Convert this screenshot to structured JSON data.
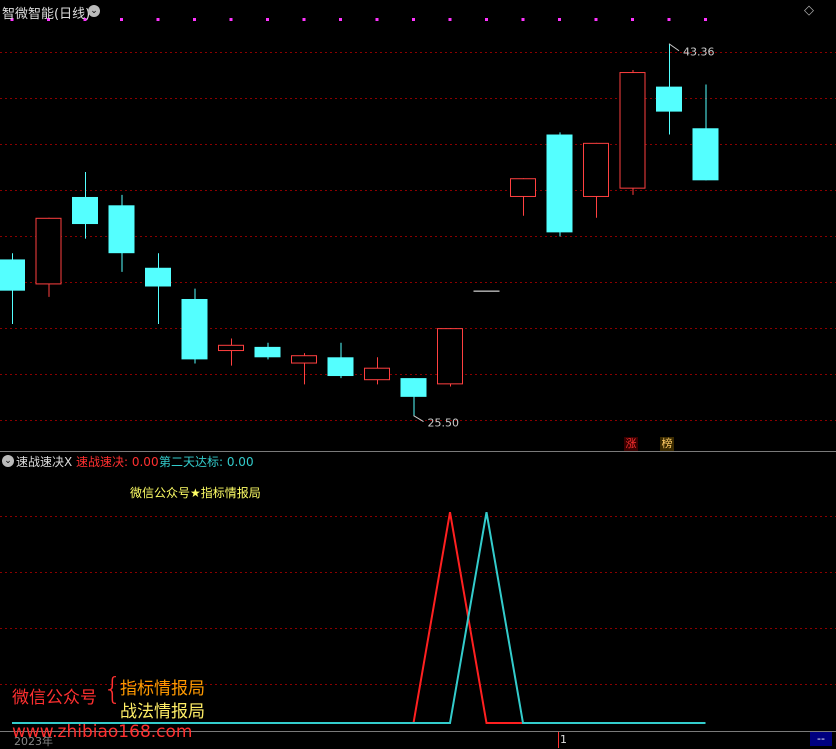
{
  "main_panel": {
    "title": "智微智能(日线)",
    "high_label": "43.36",
    "low_label": "25.50",
    "badge_left": "涨",
    "badge_right": "榜"
  },
  "indicator_panel": {
    "title": "速战速决X",
    "legend": [
      {
        "label": "速战速决: 0.00",
        "color": "#ff3030"
      },
      {
        "label": "第二天达标: 0.00",
        "color": "#33cccc"
      }
    ],
    "watermark": "微信公众号★指标情报局",
    "promo_left": "微信公众号",
    "promo_line1": "指标情报局",
    "promo_line2": "战法情报局",
    "url": "www.zhibiao168.com",
    "year_label": "2023年",
    "cursor_label": "1",
    "corner_label": "--"
  },
  "colors": {
    "up": "#ff4040",
    "down": "#54ffff",
    "grid": "#8b0000",
    "signal_marker": "#ff33ff",
    "series_red": "#ff2020",
    "series_cyan": "#33cccc"
  },
  "chart_data": [
    {
      "type": "candlestick",
      "title": "智微智能(日线)",
      "ylim": [
        25.0,
        44.5
      ],
      "candles": [
        {
          "open": 33.0,
          "close": 31.5,
          "high": 33.3,
          "low": 29.9
        },
        {
          "open": 31.8,
          "close": 35.0,
          "high": 35.0,
          "low": 31.2
        },
        {
          "open": 36.0,
          "close": 34.7,
          "high": 37.2,
          "low": 34.0
        },
        {
          "open": 35.6,
          "close": 33.3,
          "high": 36.1,
          "low": 32.4
        },
        {
          "open": 32.6,
          "close": 31.7,
          "high": 33.3,
          "low": 29.9
        },
        {
          "open": 31.1,
          "close": 28.2,
          "high": 31.6,
          "low": 28.0
        },
        {
          "open": 28.6,
          "close": 28.9,
          "high": 29.2,
          "low": 27.9
        },
        {
          "open": 28.8,
          "close": 28.3,
          "high": 29.0,
          "low": 28.2
        },
        {
          "open": 28.0,
          "close": 28.4,
          "high": 28.5,
          "low": 27.0
        },
        {
          "open": 28.3,
          "close": 27.4,
          "high": 29.0,
          "low": 27.3
        },
        {
          "open": 27.2,
          "close": 27.8,
          "high": 28.3,
          "low": 27.0
        },
        {
          "open": 27.3,
          "close": 26.4,
          "high": 27.3,
          "low": 25.5
        },
        {
          "open": 27.0,
          "close": 29.7,
          "high": 29.7,
          "low": 26.9
        },
        {
          "open": 31.5,
          "close": 31.5,
          "high": 31.5,
          "low": 31.5
        },
        {
          "open": 36.0,
          "close": 36.9,
          "high": 36.9,
          "low": 35.1
        },
        {
          "open": 39.0,
          "close": 34.3,
          "high": 39.1,
          "low": 34.1
        },
        {
          "open": 36.0,
          "close": 38.6,
          "high": 38.6,
          "low": 35.0
        },
        {
          "open": 36.4,
          "close": 42.0,
          "high": 42.1,
          "low": 36.1
        },
        {
          "open": 41.3,
          "close": 40.1,
          "high": 43.36,
          "low": 39.0
        },
        {
          "open": 39.3,
          "close": 36.8,
          "high": 41.4,
          "low": 36.8
        }
      ],
      "signal_marker_indices": [
        0,
        1,
        2,
        3,
        4,
        5,
        6,
        7,
        8,
        9,
        10,
        11,
        12,
        13,
        14,
        15,
        16,
        17,
        18,
        19
      ]
    },
    {
      "type": "line",
      "title": "速战速决X",
      "ylim": [
        0,
        1.2
      ],
      "x": [
        0,
        1,
        2,
        3,
        4,
        5,
        6,
        7,
        8,
        9,
        10,
        11,
        12,
        13,
        14,
        15,
        16,
        17,
        18,
        19
      ],
      "series": [
        {
          "name": "速战速决",
          "values": [
            0,
            0,
            0,
            0,
            0,
            0,
            0,
            0,
            0,
            0,
            0,
            0,
            1,
            0,
            0,
            0,
            0,
            0,
            0,
            0
          ]
        },
        {
          "name": "第二天达标",
          "values": [
            0,
            0,
            0,
            0,
            0,
            0,
            0,
            0,
            0,
            0,
            0,
            0,
            0,
            1,
            0,
            0,
            0,
            0,
            0,
            0
          ]
        }
      ]
    }
  ]
}
